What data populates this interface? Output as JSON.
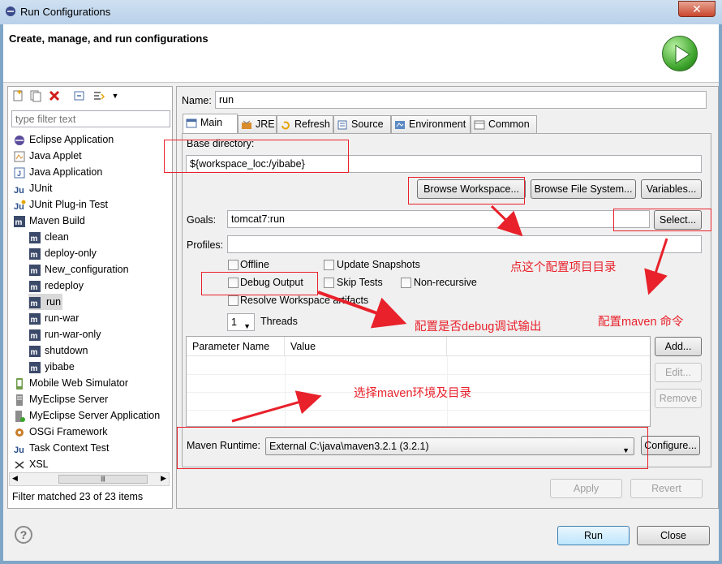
{
  "window": {
    "title": "Run Configurations",
    "close_glyph": "✕"
  },
  "header": {
    "title": "Create, manage, and run configurations"
  },
  "filter": {
    "placeholder": "type filter text"
  },
  "tree": [
    {
      "label": "Eclipse Application",
      "icon": "eclipse-icon"
    },
    {
      "label": "Java Applet",
      "icon": "applet-icon"
    },
    {
      "label": "Java Application",
      "icon": "java-app-icon"
    },
    {
      "label": "JUnit",
      "icon": "junit-icon"
    },
    {
      "label": "JUnit Plug-in Test",
      "icon": "junit-plugin-icon"
    },
    {
      "label": "Maven Build",
      "icon": "maven-icon"
    },
    {
      "label": "clean",
      "icon": "maven-icon"
    },
    {
      "label": "deploy-only",
      "icon": "maven-icon"
    },
    {
      "label": "New_configuration",
      "icon": "maven-icon"
    },
    {
      "label": "redeploy",
      "icon": "maven-icon"
    },
    {
      "label": "run",
      "icon": "maven-icon",
      "selected": true
    },
    {
      "label": "run-war",
      "icon": "maven-icon"
    },
    {
      "label": "run-war-only",
      "icon": "maven-icon"
    },
    {
      "label": "shutdown",
      "icon": "maven-icon"
    },
    {
      "label": "yibabe",
      "icon": "maven-icon"
    },
    {
      "label": "Mobile Web Simulator",
      "icon": "mobile-icon"
    },
    {
      "label": "MyEclipse Server",
      "icon": "server-icon"
    },
    {
      "label": "MyEclipse Server Application",
      "icon": "server-app-icon"
    },
    {
      "label": "OSGi Framework",
      "icon": "osgi-icon"
    },
    {
      "label": "Task Context Test",
      "icon": "task-icon"
    },
    {
      "label": "XSL",
      "icon": "xsl-icon"
    }
  ],
  "filter_matched": "Filter matched 23 of 23 items",
  "name": {
    "label": "Name:",
    "value": "run"
  },
  "tabs": [
    "Main",
    "JRE",
    "Refresh",
    "Source",
    "Environment",
    "Common"
  ],
  "main": {
    "base_dir_label": "Base directory:",
    "base_dir_value": "${workspace_loc:/yibabe}",
    "browse_workspace": "Browse Workspace...",
    "browse_fs": "Browse File System...",
    "variables": "Variables...",
    "goals_label": "Goals:",
    "goals_value": "tomcat7:run",
    "select": "Select...",
    "profiles_label": "Profiles:",
    "profiles_value": "",
    "offline": "Offline",
    "update_snapshots": "Update Snapshots",
    "debug_output": "Debug Output",
    "skip_tests": "Skip Tests",
    "non_recursive": "Non-recursive",
    "resolve_ws": "Resolve Workspace artifacts",
    "threads_value": "1",
    "threads_label": "Threads",
    "param_col_name": "Parameter Name",
    "param_col_value": "Value",
    "add": "Add...",
    "edit": "Edit...",
    "remove": "Remove",
    "runtime_label": "Maven Runtime:",
    "runtime_value": "External C:\\java\\maven3.2.1 (3.2.1)",
    "configure": "Configure..."
  },
  "annotations": {
    "project_dir": "点这个配置项目目录",
    "maven_cmd": "配置maven 命令",
    "debug": "配置是否debug调试输出",
    "maven_env": "选择maven环境及目录"
  },
  "footer": {
    "apply": "Apply",
    "revert": "Revert",
    "run": "Run",
    "close": "Close"
  },
  "colors": {
    "accent": "#3399ff",
    "annotation": "#e8212b"
  }
}
